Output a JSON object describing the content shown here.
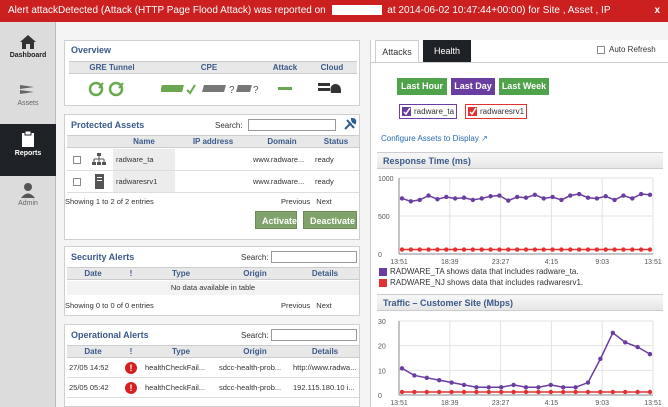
{
  "alert": {
    "prefix": "Alert  attackDetected (Attack (HTTP Page Flood Attack) was reported on",
    "suffix": "at 2014-06-02 10:47:44+00:00) for Site  , Asset  , IP",
    "close": "x"
  },
  "nav": [
    {
      "label": "Dashboard",
      "icon": "home-icon",
      "active": false
    },
    {
      "label": "Assets",
      "icon": "layers-icon",
      "active": false
    },
    {
      "label": "Reports",
      "icon": "clipboard-icon",
      "active": true
    },
    {
      "label": "Admin",
      "icon": "user-icon",
      "active": false
    }
  ],
  "overview": {
    "title": "Overview",
    "columns": [
      "GRE Tunnel",
      "CPE",
      "Attack",
      "Cloud"
    ]
  },
  "protected_assets": {
    "title": "Protected Assets",
    "search_label": "Search:",
    "columns": [
      "Name",
      "IP address",
      "Domain",
      "Status"
    ],
    "rows": [
      {
        "name": "radware_ta",
        "ip": "",
        "domain": "www.radware...",
        "status": "ready"
      },
      {
        "name": "radwaresrv1",
        "ip": "",
        "domain": "www.radware...",
        "status": "ready"
      }
    ],
    "info": "Showing 1 to 2 of 2 entries",
    "prev": "Previous",
    "next": "Next",
    "activate": "Activate",
    "deactivate": "Deactivate"
  },
  "security_alerts": {
    "title": "Security Alerts",
    "search_label": "Search:",
    "columns": [
      "Date",
      "!",
      "Type",
      "Origin",
      "Details"
    ],
    "empty": "No data available in table",
    "info": "Showing 0 to 0 of 0 entries",
    "prev": "Previous",
    "next": "Next"
  },
  "operational_alerts": {
    "title": "Operational Alerts",
    "search_label": "Search:",
    "columns": [
      "Date",
      "!",
      "Type",
      "Origin",
      "Details"
    ],
    "rows": [
      {
        "date": "27/05 14:52",
        "type": "healthCheckFail...",
        "origin": "sdcc-health-prob...",
        "details": "http://www.radwa..."
      },
      {
        "date": "25/05 05:42",
        "type": "healthCheckFail...",
        "origin": "sdcc-health-prob...",
        "details": "192.115.180.10 i..."
      }
    ]
  },
  "right": {
    "tabs": [
      "Attacks",
      "Health"
    ],
    "auto_refresh": "Auto Refresh",
    "range_buttons": [
      "Last Hour",
      "Last Day",
      "Last Week"
    ],
    "chips": [
      "radware_ta",
      "radwaresrv1"
    ],
    "configure_link": "Configure Assets to Display",
    "colors": {
      "purple": "#6a3da0",
      "red": "#e33030",
      "green": "#4fa34a"
    }
  },
  "chart_data": [
    {
      "type": "line",
      "title": "Response Time (ms)",
      "x_ticks": [
        "13:51",
        "18:39",
        "23:27",
        "4:15",
        "9:03",
        "13:51"
      ],
      "y_ticks": [
        "1000",
        "500",
        "0"
      ],
      "ylim": [
        0,
        1000
      ],
      "series": [
        {
          "name": "RADWARE_TA",
          "values": [
            720,
            680,
            700,
            760,
            710,
            740,
            720,
            730,
            700,
            720,
            750,
            760,
            690,
            740,
            730,
            770,
            720,
            740,
            700,
            760,
            780,
            730,
            720,
            750,
            700,
            760,
            720,
            780,
            770
          ]
        },
        {
          "name": "RADWARE_NJ",
          "values": [
            20,
            20,
            20,
            20,
            20,
            20,
            20,
            20,
            20,
            20,
            20,
            20,
            20,
            20,
            20,
            20,
            20,
            20,
            20,
            20,
            20,
            20,
            20,
            20,
            20,
            20,
            20,
            20,
            20
          ]
        }
      ],
      "legend": [
        "RADWARE_TA shows data that includes radware_ta.",
        "RADWARE_NJ shows data that includes radwaresrv1."
      ]
    },
    {
      "type": "line",
      "title": "Traffic – Customer Site (Mbps)",
      "x_ticks": [
        "13:51",
        "18:39",
        "23:27",
        "4:15",
        "9:03",
        "13:51"
      ],
      "y_ticks": [
        "30",
        "20",
        "10",
        "0"
      ],
      "ylim": [
        0,
        30
      ],
      "series": [
        {
          "name": "RADWARE_TA",
          "values": [
            10,
            7,
            6,
            5,
            4,
            3,
            2,
            2,
            2,
            3,
            2,
            2,
            3,
            2,
            2,
            4,
            14,
            25,
            21,
            19,
            16
          ]
        },
        {
          "name": "RADWARE_NJ",
          "values": [
            0,
            0,
            0,
            0,
            0,
            0,
            0,
            0,
            0,
            0,
            0,
            0,
            0,
            0,
            0,
            0,
            0,
            0,
            0,
            0,
            0
          ]
        }
      ]
    }
  ]
}
